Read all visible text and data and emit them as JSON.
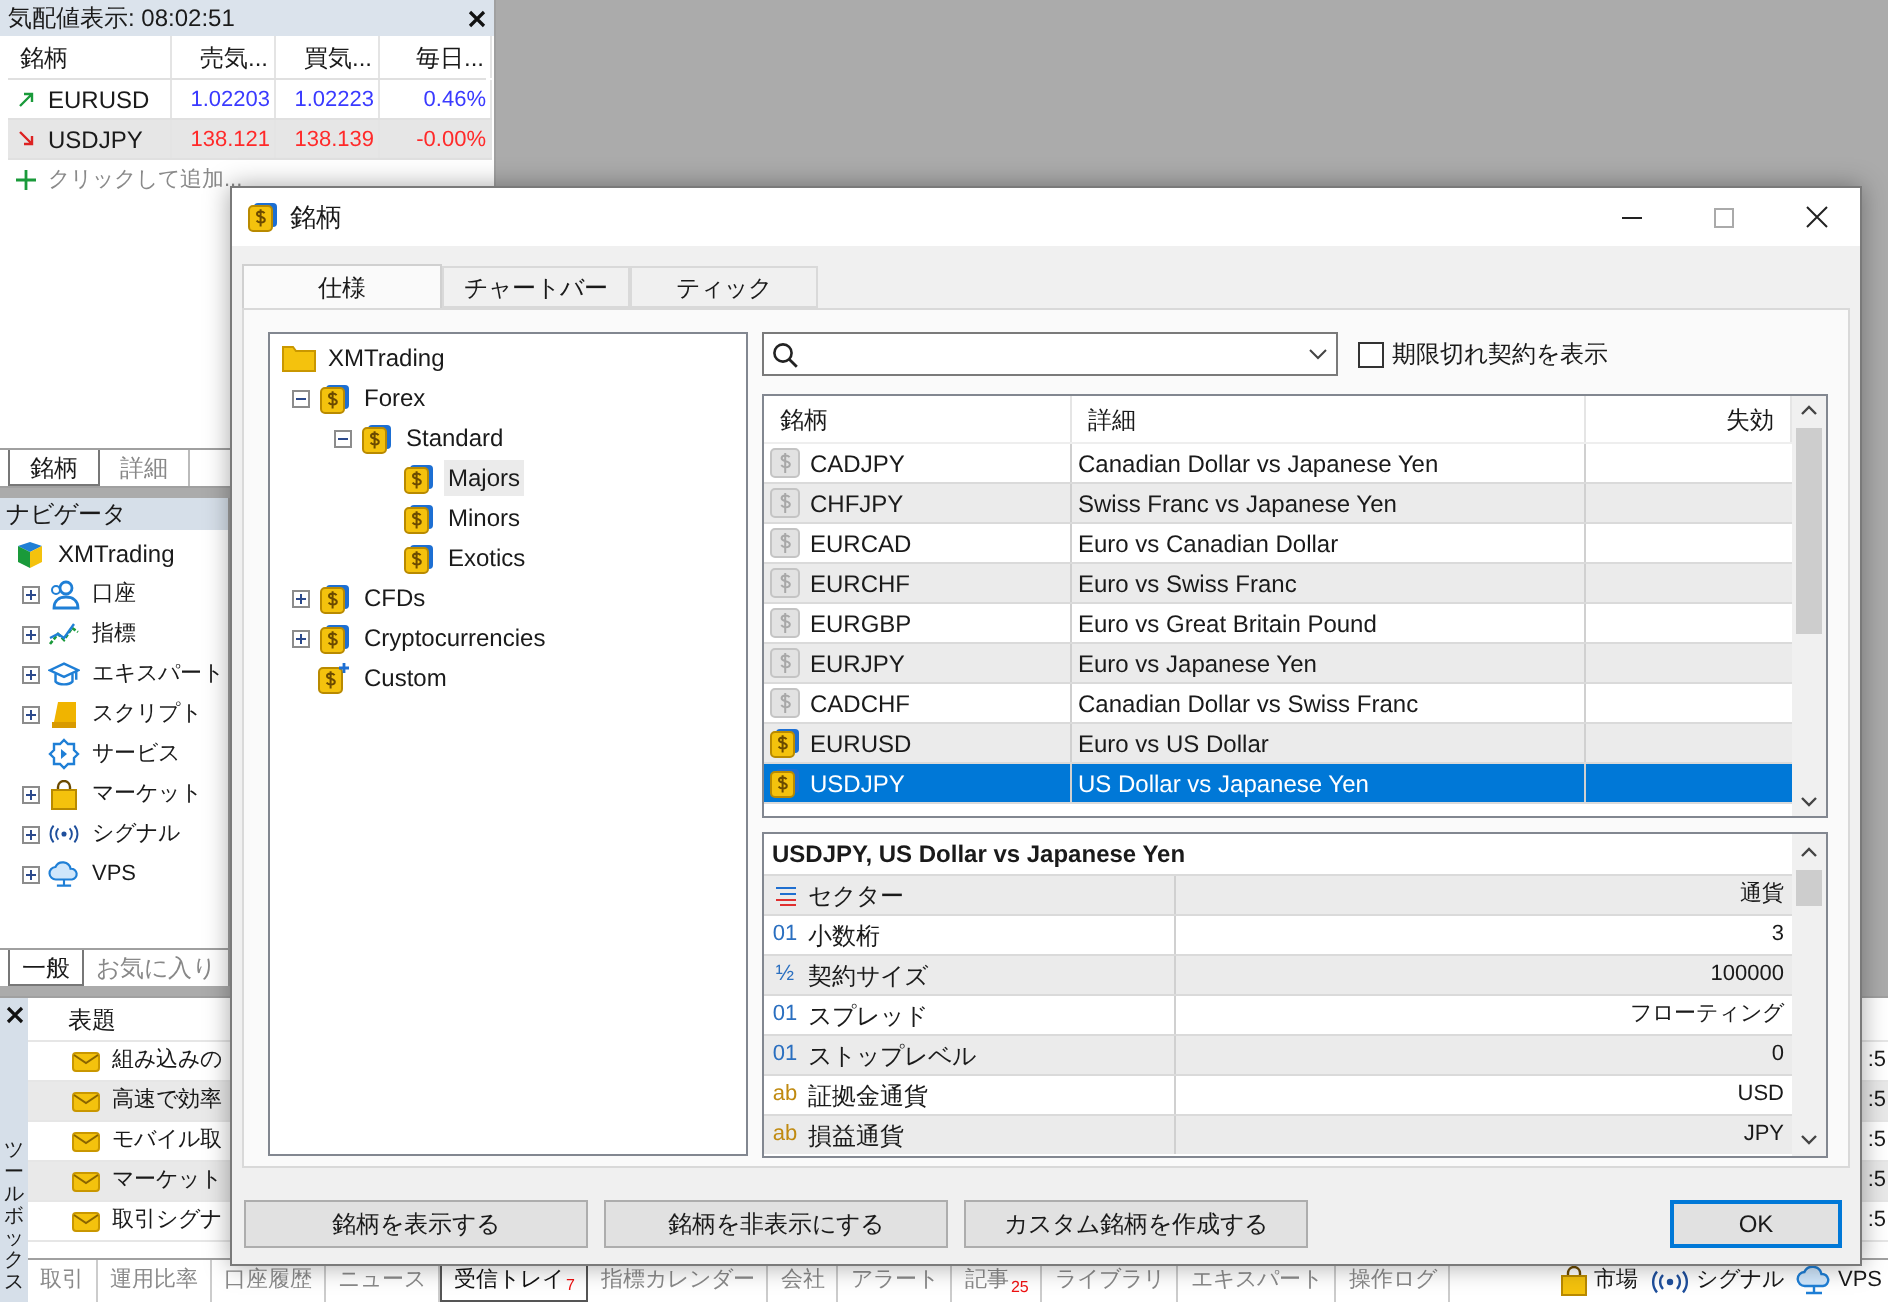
{
  "market_watch": {
    "title": "気配値表示: 08:02:51",
    "columns": [
      "銘柄",
      "売気...",
      "買気...",
      "毎日..."
    ],
    "rows": [
      {
        "symbol": "EURUSD",
        "kind": "up",
        "bid": "1.02203",
        "ask": "1.02223",
        "change": "0.46%",
        "selected": false
      },
      {
        "symbol": "USDJPY",
        "kind": "down",
        "bid": "138.121",
        "ask": "138.139",
        "change": "-0.00%",
        "selected": true
      }
    ],
    "add_row": "クリックして追加...",
    "tabs": [
      {
        "label": "銘柄",
        "selected": true
      },
      {
        "label": "詳細",
        "selected": false
      }
    ]
  },
  "navigator": {
    "title": "ナビゲータ",
    "root": "XMTrading",
    "items": [
      {
        "label": "口座",
        "kind": "account",
        "expandable": true
      },
      {
        "label": "指標",
        "kind": "indicator",
        "expandable": true
      },
      {
        "label": "エキスパート",
        "kind": "expert",
        "expandable": true
      },
      {
        "label": "スクリプト",
        "kind": "script",
        "expandable": true
      },
      {
        "label": "サービス",
        "kind": "service",
        "expandable": false
      },
      {
        "label": "マーケット",
        "kind": "market",
        "expandable": true
      },
      {
        "label": "シグナル",
        "kind": "signal",
        "expandable": true
      },
      {
        "label": "VPS",
        "kind": "cloud",
        "expandable": true
      }
    ],
    "tabs": [
      {
        "label": "一般",
        "selected": true
      },
      {
        "label": "お気に入り",
        "selected": false
      }
    ]
  },
  "toolbox": {
    "title": "ツールボックス",
    "column": "表題",
    "messages": [
      {
        "subject": "組み込みの",
        "time": ":5"
      },
      {
        "subject": "高速で効率",
        "time": ":5"
      },
      {
        "subject": "モバイル取",
        "time": ":5"
      },
      {
        "subject": "マーケット",
        "time": ":5"
      },
      {
        "subject": "取引シグナ",
        "time": ":5"
      }
    ],
    "tabs": [
      {
        "label": "取引",
        "selected": false
      },
      {
        "label": "運用比率",
        "selected": false
      },
      {
        "label": "口座履歴",
        "selected": false
      },
      {
        "label": "ニュース",
        "selected": false
      },
      {
        "label": "受信トレイ",
        "badge": "7",
        "selected": true
      },
      {
        "label": "指標カレンダー",
        "selected": false
      },
      {
        "label": "会社",
        "selected": false
      },
      {
        "label": "アラート",
        "selected": false
      },
      {
        "label": "記事",
        "badge": "25",
        "selected": false
      },
      {
        "label": "ライブラリ",
        "selected": false
      },
      {
        "label": "エキスパート",
        "selected": false
      },
      {
        "label": "操作ログ",
        "selected": false
      }
    ],
    "status": [
      {
        "label": "市場",
        "kind": "market"
      },
      {
        "label": "シグナル",
        "kind": "signal"
      },
      {
        "label": "VPS",
        "kind": "cloud"
      }
    ]
  },
  "dialog": {
    "title": "銘柄",
    "tabs": [
      {
        "label": "仕様",
        "selected": true
      },
      {
        "label": "チャートバー",
        "selected": false
      },
      {
        "label": "ティック",
        "selected": false
      }
    ],
    "tree": [
      {
        "label": "XMTrading",
        "kind": "folder",
        "selected": false,
        "children": [
          {
            "label": "Forex",
            "kind": "symbol",
            "expanded": true,
            "selected": false,
            "children": [
              {
                "label": "Standard",
                "kind": "symbol",
                "expanded": true,
                "selected": false,
                "children": [
                  {
                    "label": "Majors",
                    "kind": "symbol",
                    "selected": true
                  },
                  {
                    "label": "Minors",
                    "kind": "symbol",
                    "selected": false
                  },
                  {
                    "label": "Exotics",
                    "kind": "symbol",
                    "selected": false
                  }
                ]
              }
            ]
          },
          {
            "label": "CFDs",
            "kind": "symbol",
            "expanded": false,
            "selected": false
          },
          {
            "label": "Cryptocurrencies",
            "kind": "symbol",
            "expanded": false,
            "selected": false
          },
          {
            "label": "Custom",
            "kind": "custom",
            "selected": false
          }
        ]
      }
    ],
    "show_expired": {
      "label": "期限切れ契約を表示",
      "checked": false
    },
    "symbols": {
      "columns": [
        "銘柄",
        "詳細",
        "失効"
      ],
      "rows": [
        {
          "symbol": "CADJPY",
          "description": "Canadian Dollar vs Japanese Yen",
          "enabled": false,
          "selected": false
        },
        {
          "symbol": "CHFJPY",
          "description": "Swiss Franc vs Japanese Yen",
          "enabled": false,
          "selected": false
        },
        {
          "symbol": "EURCAD",
          "description": "Euro vs Canadian Dollar",
          "enabled": false,
          "selected": false
        },
        {
          "symbol": "EURCHF",
          "description": "Euro vs Swiss Franc",
          "enabled": false,
          "selected": false
        },
        {
          "symbol": "EURGBP",
          "description": "Euro vs Great Britain Pound",
          "enabled": false,
          "selected": false
        },
        {
          "symbol": "EURJPY",
          "description": "Euro vs Japanese Yen",
          "enabled": false,
          "selected": false
        },
        {
          "symbol": "CADCHF",
          "description": "Canadian Dollar vs Swiss Franc",
          "enabled": false,
          "selected": false
        },
        {
          "symbol": "EURUSD",
          "description": "Euro vs US Dollar",
          "enabled": true,
          "selected": false
        },
        {
          "symbol": "USDJPY",
          "description": "US Dollar vs Japanese Yen",
          "enabled": true,
          "selected": true
        }
      ]
    },
    "details": {
      "title": "USDJPY, US Dollar vs Japanese Yen",
      "rows": [
        {
          "kind": "list",
          "name": "セクター",
          "value": "通貨"
        },
        {
          "kind": "number",
          "mark": "01",
          "name": "小数桁",
          "value": "3"
        },
        {
          "kind": "number",
          "mark": "½",
          "name": "契約サイズ",
          "value": "100000"
        },
        {
          "kind": "number",
          "mark": "01",
          "name": "スプレッド",
          "value": "フローティング"
        },
        {
          "kind": "number",
          "mark": "01",
          "name": "ストップレベル",
          "value": "0"
        },
        {
          "kind": "string",
          "mark": "ab",
          "name": "証拠金通貨",
          "value": "USD"
        },
        {
          "kind": "string",
          "mark": "ab",
          "name": "損益通貨",
          "value": "JPY"
        }
      ]
    },
    "buttons": [
      {
        "label": "銘柄を表示する",
        "default": false
      },
      {
        "label": "銘柄を非表示にする",
        "default": false
      },
      {
        "label": "カスタム銘柄を作成する",
        "default": false
      },
      {
        "label": "OK",
        "default": true
      }
    ]
  }
}
